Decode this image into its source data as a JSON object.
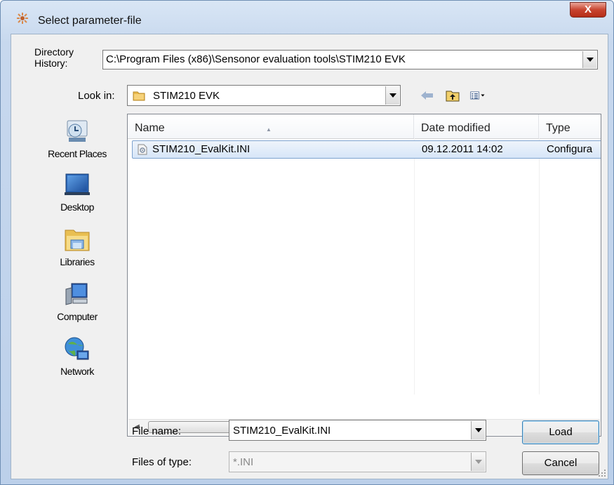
{
  "window": {
    "title": "Select parameter-file",
    "close_label": "X"
  },
  "directory_history": {
    "label_line1": "Directory",
    "label_line2": "History:",
    "value": "C:\\Program Files (x86)\\Sensonor evaluation tools\\STIM210 EVK"
  },
  "look_in": {
    "label": "Look in:",
    "value": "STIM210 EVK"
  },
  "places": [
    {
      "label": "Recent Places",
      "icon": "recent-places-icon"
    },
    {
      "label": "Desktop",
      "icon": "desktop-icon"
    },
    {
      "label": "Libraries",
      "icon": "libraries-icon"
    },
    {
      "label": "Computer",
      "icon": "computer-icon"
    },
    {
      "label": "Network",
      "icon": "network-icon"
    }
  ],
  "file_list": {
    "columns": [
      "Name",
      "Date modified",
      "Type"
    ],
    "rows": [
      {
        "name": "STIM210_EvalKit.INI",
        "date_modified": "09.12.2011 14:02",
        "type": "Configura",
        "selected": true
      }
    ],
    "scroll_grip": "III"
  },
  "file_name": {
    "label": "File name:",
    "value": "STIM210_EvalKit.INI"
  },
  "files_of_type": {
    "label": "Files of type:",
    "value": "*.INI"
  },
  "buttons": {
    "load": "Load",
    "cancel": "Cancel"
  },
  "colors": {
    "selection": "#d7e6f8",
    "selection_border": "#7da2ce",
    "close_button": "#c8442f"
  }
}
